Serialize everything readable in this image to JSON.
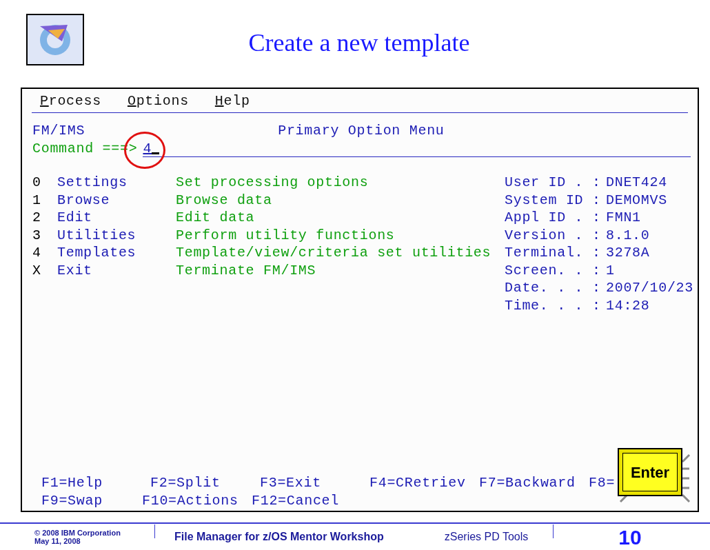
{
  "slide": {
    "title": "Create a new template"
  },
  "terminal": {
    "menu": [
      "Process",
      "Options",
      "Help"
    ],
    "panel_id": "FM/IMS",
    "panel_title": "Primary Option Menu",
    "command": {
      "label": "Command ===>",
      "value": "4"
    },
    "options": [
      {
        "key": "0",
        "name": "Settings",
        "description": "Set processing options"
      },
      {
        "key": "1",
        "name": "Browse",
        "description": "Browse data"
      },
      {
        "key": "2",
        "name": "Edit",
        "description": "Edit data"
      },
      {
        "key": "3",
        "name": "Utilities",
        "description": "Perform utility functions"
      },
      {
        "key": "4",
        "name": "Templates",
        "description": "Template/view/criteria set utilities"
      },
      {
        "key": "X",
        "name": "Exit",
        "description": "Terminate FM/IMS"
      }
    ],
    "info": [
      {
        "label": "User ID . :",
        "value": "DNET424"
      },
      {
        "label": "System ID :",
        "value": "DEMOMVS"
      },
      {
        "label": "Appl ID . :",
        "value": "FMN1"
      },
      {
        "label": "Version . :",
        "value": "8.1.0"
      },
      {
        "label": "Terminal. :",
        "value": "3278A"
      },
      {
        "label": "Screen. . :",
        "value": "1"
      },
      {
        "label": "Date. . . :",
        "value": "2007/10/23"
      },
      {
        "label": "Time. . . :",
        "value": "14:28"
      }
    ],
    "function_keys": [
      [
        "F1=Help",
        "F2=Split",
        "F3=Exit",
        "F4=CRetriev",
        "F7=Backward",
        "F8="
      ],
      [
        "F9=Swap",
        "F10=Actions",
        "F12=Cancel"
      ]
    ]
  },
  "enter_key": {
    "label": "Enter"
  },
  "footer": {
    "copyright": "© 2008 IBM Corporation",
    "date": "May 11, 2008",
    "title": "File Manager for z/OS Mentor Workshop",
    "subtitle": "zSeries PD Tools",
    "page": "10"
  }
}
